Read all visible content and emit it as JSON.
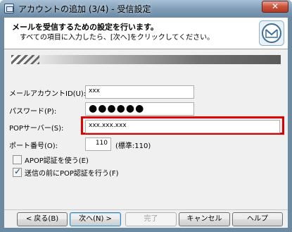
{
  "window": {
    "title": "アカウントの追加 (3/4) - 受信設定",
    "close_glyph": "✕"
  },
  "header": {
    "title": "メールを受信するための設定を行います。",
    "subtitle": "すべての項目に入力したら、[次へ]をクリックしてください。"
  },
  "form": {
    "account_id": {
      "label": "メールアカウントID(U):",
      "value": "xxx"
    },
    "password": {
      "label": "パスワード(P):",
      "value": "●●●●●●"
    },
    "pop_server": {
      "label": "POPサーバー(S):",
      "value": "xxx.xxx.xxx"
    },
    "port": {
      "label": "ポート番号(O):",
      "value": "110",
      "note": "(標準:110)"
    }
  },
  "options": {
    "apop": {
      "label": "APOP認証を使う(E)",
      "checked": false
    },
    "pop_before_send": {
      "label": "送信の前にPOP認証を行う(F)",
      "checked": true
    }
  },
  "buttons": {
    "back": "< 戻る(B)",
    "next": "次へ(N) >",
    "finish": "完了",
    "cancel": "キャンセル",
    "help": "ヘルプ"
  },
  "icons": {
    "window_icon": "window-app-icon",
    "logo": "mail-logo-icon",
    "close": "close-icon"
  },
  "colors": {
    "highlight": "#e00000",
    "titlebar": "#7e9cb6"
  }
}
